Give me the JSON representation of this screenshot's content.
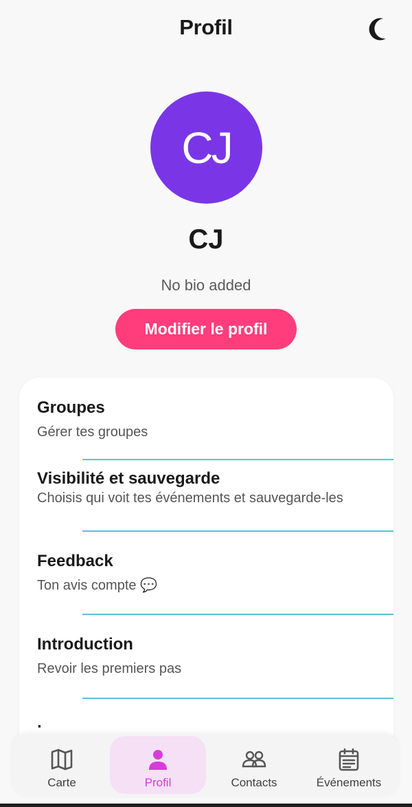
{
  "header": {
    "title": "Profil",
    "theme_icon": "moon-icon"
  },
  "profile": {
    "initials": "CJ",
    "name": "CJ",
    "bio": "No bio added",
    "edit_label": "Modifier le profil",
    "avatar_color": "#7a36e6"
  },
  "menu": {
    "items": [
      {
        "title": "Groupes",
        "subtitle": "Gérer tes groupes"
      },
      {
        "title": "Visibilité et sauvegarde",
        "subtitle": "Choisis qui voit tes événements et sauvegarde-les"
      },
      {
        "title": "Feedback",
        "subtitle": "Ton avis compte 💬"
      },
      {
        "title": "Introduction",
        "subtitle": "Revoir les premiers pas"
      }
    ]
  },
  "nav": {
    "active": "Profil",
    "items": [
      {
        "label": "Carte",
        "icon": "map-icon"
      },
      {
        "label": "Profil",
        "icon": "user-icon"
      },
      {
        "label": "Contacts",
        "icon": "users-icon"
      },
      {
        "label": "Événements",
        "icon": "calendar-icon"
      }
    ]
  },
  "colors": {
    "accent_pink": "#ff3d7d",
    "divider_cyan": "#5bc1d9",
    "nav_active_bg": "#f5e0f6",
    "nav_active_text": "#d63cd9"
  }
}
